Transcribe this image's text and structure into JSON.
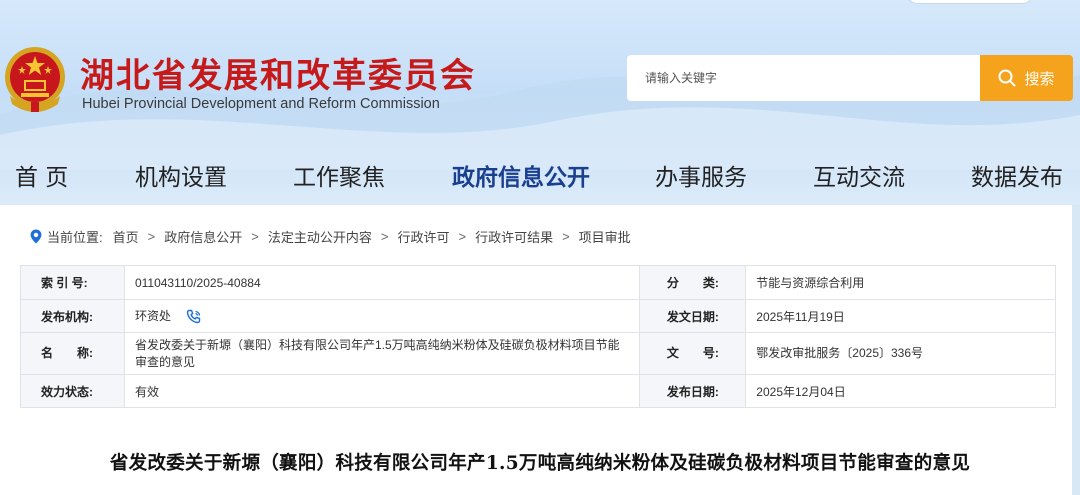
{
  "header": {
    "title": "湖北省发展和改革委员会",
    "subtitle": "Hubei Provincial Development and Reform Commission"
  },
  "search": {
    "placeholder": "请输入关键字",
    "button_label": "搜索"
  },
  "nav": [
    {
      "label": "首 页"
    },
    {
      "label": "机构设置"
    },
    {
      "label": "工作聚焦"
    },
    {
      "label": "政府信息公开",
      "active": true
    },
    {
      "label": "办事服务"
    },
    {
      "label": "互动交流"
    },
    {
      "label": "数据发布"
    }
  ],
  "breadcrumb": {
    "prefix": "当前位置:",
    "items": [
      "首页",
      "政府信息公开",
      "法定主动公开内容",
      "行政许可",
      "行政许可结果",
      "项目审批"
    ]
  },
  "info": {
    "index_no_label": "索 引 号:",
    "index_no": "011043110/2025-40884",
    "category_label": "分　　类:",
    "category": "节能与资源综合利用",
    "publisher_label": "发布机构:",
    "publisher": "环资处",
    "issue_date_label": "发文日期:",
    "issue_date": "2025年11月19日",
    "name_label": "名　　称:",
    "name": "省发改委关于新塬（襄阳）科技有限公司年产1.5万吨高纯纳米粉体及硅碳负极材料项目节能审查的意见",
    "doc_no_label": "文　　号:",
    "doc_no": "鄂发改审批服务〔2025〕336号",
    "status_label": "效力状态:",
    "status": "有效",
    "publish_date_label": "发布日期:",
    "publish_date": "2025年12月04日"
  },
  "document": {
    "title": "省发改委关于新塬（襄阳）科技有限公司年产1.5万吨高纯纳米粉体及硅碳负极材料项目节能审查的意见"
  },
  "colors": {
    "brand_red": "#c61a1a",
    "search_orange": "#f5a31c",
    "nav_active": "#1a3f8f"
  }
}
